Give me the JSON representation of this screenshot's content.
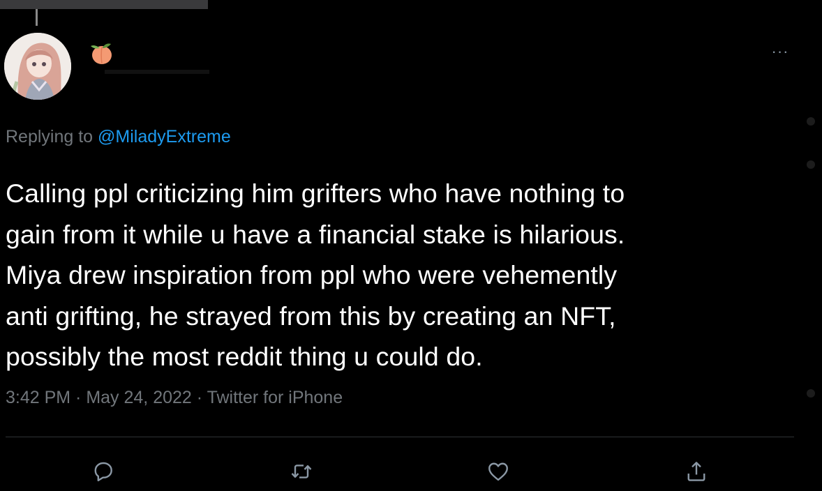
{
  "tweet": {
    "replying_prefix": "Replying to",
    "replying_handle": "@MiladyExtreme",
    "lines": [
      "Calling ppl criticizing him grifters who have nothing to",
      "gain from it while u have a financial stake is hilarious.",
      "Miya drew inspiration from ppl who were vehemently",
      "anti grifting, he strayed from this by creating an NFT,",
      "possibly the most reddit thing u could do."
    ],
    "meta": "3:42 PM · May 24, 2022 · Twitter for iPhone"
  },
  "header": {
    "more_label": "···",
    "name_emoji": "peach-icon"
  },
  "actions": {
    "reply": "reply-icon",
    "retweet": "retweet-icon",
    "like": "heart-icon",
    "share": "share-icon"
  },
  "colors": {
    "background": "#000000",
    "text": "#ffffff",
    "secondary": "#71767b",
    "link": "#1d9bf0",
    "icon": "#8b98a5"
  }
}
